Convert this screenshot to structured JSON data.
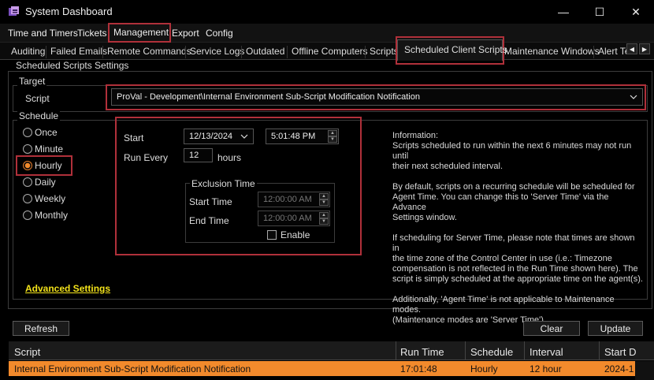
{
  "window": {
    "title": "System Dashboard",
    "icon": "app-icon",
    "controls": {
      "minimize": "—",
      "maximize": "☐",
      "close": "✕"
    }
  },
  "menu": {
    "items": [
      "Time and Timers",
      "Tickets",
      "Management",
      "Export",
      "Config"
    ]
  },
  "tabs": {
    "items": [
      "Auditing",
      "Failed Emails",
      "Remote Commands",
      "Service Logs",
      "Outdated",
      "Offline Computers",
      "Scripts",
      "Scheduled Client Scripts",
      "Maintenance Windows",
      "Alert Te"
    ],
    "active": "Scheduled Client Scripts",
    "scroll_left": "◀",
    "scroll_right": "▶"
  },
  "panel": {
    "title": "Scheduled Scripts Settings",
    "target": {
      "group_label": "Target",
      "script_label": "Script",
      "script_value": "ProVal - Development\\Internal Environment Sub-Script Modification Notification"
    },
    "schedule": {
      "group_label": "Schedule",
      "options": [
        "Once",
        "Minute",
        "Hourly",
        "Daily",
        "Weekly",
        "Monthly"
      ],
      "selected": "Hourly"
    },
    "timing": {
      "start_label": "Start",
      "start_date": "12/13/2024",
      "start_time": "5:01:48 PM",
      "run_every_label": "Run Every",
      "run_every_value": "12",
      "run_every_unit": "hours",
      "exclusion": {
        "group_label": "Exclusion Time",
        "start_label": "Start Time",
        "start_value": "12:00:00 AM",
        "end_label": "End Time",
        "end_value": "12:00:00 AM",
        "enable_label": "Enable"
      }
    },
    "info_lines": [
      "Information:",
      "Scripts scheduled to run within the next 6 minutes may not run until",
      "their next scheduled interval.",
      "",
      "By default, scripts on a recurring schedule will be scheduled for",
      "Agent Time. You can change this to 'Server Time' via the Advance",
      "Settings window.",
      "",
      "If scheduling for Server Time, please note that times are shown in",
      "the time zone of the Control Center in use (i.e.: Timezone",
      "compensation is not reflected in the Run Time shown here). The",
      "script is simply scheduled at the appropriate time on the agent(s).",
      "",
      "Additionally, 'Agent Time' is not applicable to Maintenance modes.",
      "(Maintenance modes are 'Server Time')"
    ],
    "advanced_settings": "Advanced Settings"
  },
  "buttons": {
    "refresh": "Refresh",
    "clear": "Clear",
    "update": "Update"
  },
  "grid": {
    "columns": [
      "Script",
      "Run Time",
      "Schedule",
      "Interval",
      "Start D"
    ],
    "rows": [
      [
        "Internal Environment Sub-Script Modification Notification",
        "17:01:48",
        "Hourly",
        "12 hour",
        "2024-1"
      ]
    ]
  },
  "colors": {
    "accent": "#f28a2c",
    "highlight_border": "#b0303a",
    "link": "#f2e21a",
    "background": "#000000"
  }
}
